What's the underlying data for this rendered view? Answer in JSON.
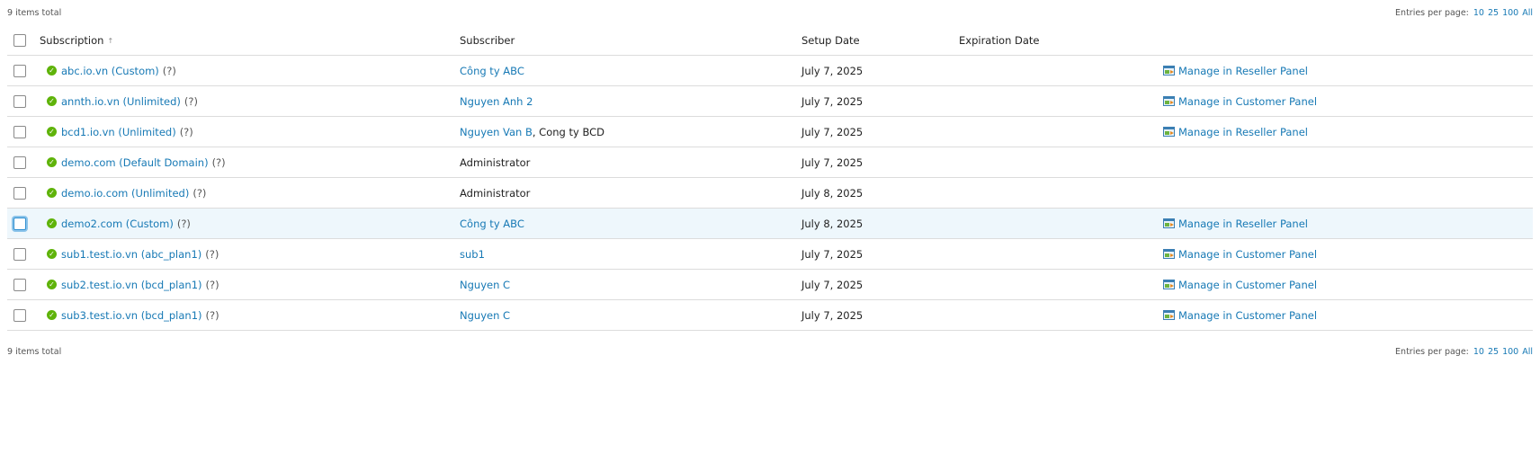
{
  "summary": {
    "total_text": "9 items total",
    "entries_label": "Entries per page:",
    "page_sizes": [
      "10",
      "25",
      "100",
      "All"
    ]
  },
  "columns": {
    "subscription": "Subscription",
    "sort_indicator": "↑",
    "subscriber": "Subscriber",
    "setup_date": "Setup Date",
    "expiration_date": "Expiration Date"
  },
  "help_mark": "(?)",
  "rows": [
    {
      "subscription": "abc.io.vn (Custom)",
      "subscriber": "Công ty ABC",
      "subscriber_link": true,
      "subscriber_extra": "",
      "setup_date": "July 7, 2025",
      "expiration_date": "",
      "manage": "Manage in Reseller Panel"
    },
    {
      "subscription": "annth.io.vn (Unlimited)",
      "subscriber": "Nguyen Anh 2",
      "subscriber_link": true,
      "subscriber_extra": "",
      "setup_date": "July 7, 2025",
      "expiration_date": "",
      "manage": "Manage in Customer Panel"
    },
    {
      "subscription": "bcd1.io.vn (Unlimited)",
      "subscriber": "Nguyen Van B",
      "subscriber_link": true,
      "subscriber_extra": ", Cong ty BCD",
      "setup_date": "July 7, 2025",
      "expiration_date": "",
      "manage": "Manage in Reseller Panel"
    },
    {
      "subscription": "demo.com (Default Domain)",
      "subscriber": "Administrator",
      "subscriber_link": false,
      "subscriber_extra": "",
      "setup_date": "July 7, 2025",
      "expiration_date": "",
      "manage": ""
    },
    {
      "subscription": "demo.io.com (Unlimited)",
      "subscriber": "Administrator",
      "subscriber_link": false,
      "subscriber_extra": "",
      "setup_date": "July 8, 2025",
      "expiration_date": "",
      "manage": ""
    },
    {
      "subscription": "demo2.com (Custom)",
      "subscriber": "Công ty ABC",
      "subscriber_link": true,
      "subscriber_extra": "",
      "setup_date": "July 8, 2025",
      "expiration_date": "",
      "manage": "Manage in Reseller Panel",
      "highlight": true
    },
    {
      "subscription": "sub1.test.io.vn (abc_plan1)",
      "subscriber": "sub1",
      "subscriber_link": true,
      "subscriber_extra": "",
      "setup_date": "July 7, 2025",
      "expiration_date": "",
      "manage": "Manage in Customer Panel"
    },
    {
      "subscription": "sub2.test.io.vn (bcd_plan1)",
      "subscriber": "Nguyen C",
      "subscriber_link": true,
      "subscriber_extra": "",
      "setup_date": "July 7, 2025",
      "expiration_date": "",
      "manage": "Manage in Customer Panel"
    },
    {
      "subscription": "sub3.test.io.vn (bcd_plan1)",
      "subscriber": "Nguyen C",
      "subscriber_link": true,
      "subscriber_extra": "",
      "setup_date": "July 7, 2025",
      "expiration_date": "",
      "manage": "Manage in Customer Panel"
    }
  ],
  "colors": {
    "link": "#1779b5",
    "status_ok": "#5fb30a",
    "highlight_row": "#eef7fc"
  }
}
